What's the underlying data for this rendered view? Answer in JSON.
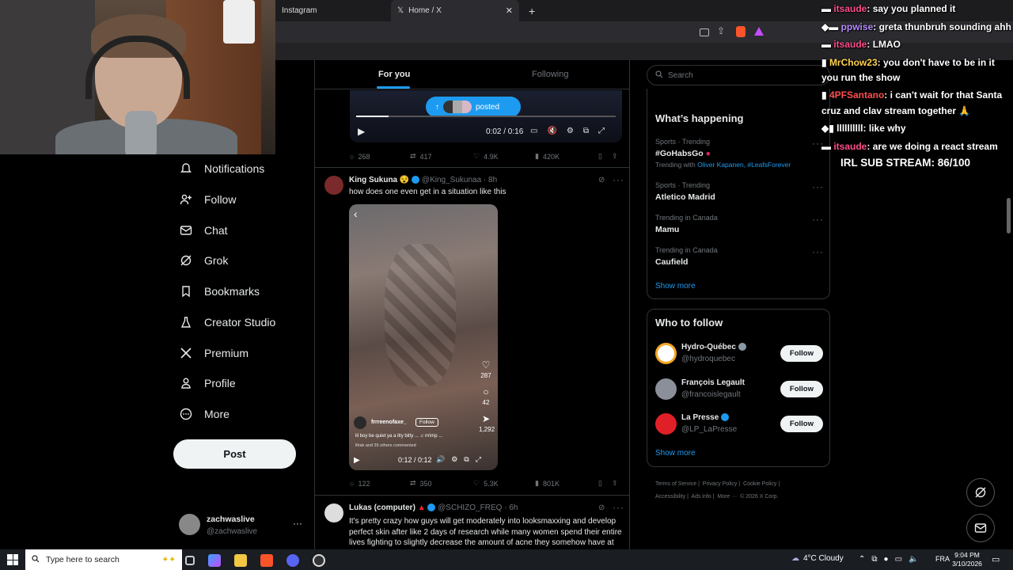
{
  "browser": {
    "tabs": [
      {
        "label": "Instagram"
      },
      {
        "label": "Home / X"
      }
    ],
    "new_tab": "+"
  },
  "nav": {
    "items": [
      {
        "label": "Notifications",
        "icon": "bell-icon"
      },
      {
        "label": "Follow",
        "icon": "person-plus-icon"
      },
      {
        "label": "Chat",
        "icon": "envelope-icon"
      },
      {
        "label": "Grok",
        "icon": "grok-icon"
      },
      {
        "label": "Bookmarks",
        "icon": "bookmark-icon"
      },
      {
        "label": "Creator Studio",
        "icon": "flask-icon"
      },
      {
        "label": "Premium",
        "icon": "x-logo-icon"
      },
      {
        "label": "Profile",
        "icon": "person-icon"
      },
      {
        "label": "More",
        "icon": "more-circle-icon"
      }
    ],
    "post_label": "Post",
    "account": {
      "name": "zachwaslive",
      "handle": "@zachwaslive",
      "more": "···"
    }
  },
  "timeline": {
    "tabs": {
      "for_you": "For you",
      "following": "Following"
    },
    "posted_pill": "posted",
    "tweet0": {
      "video_time": "0:02 / 0:16",
      "replies": "268",
      "reposts": "417",
      "likes": "4.9K",
      "views": "420K"
    },
    "tweet1": {
      "name": "King Sukuna",
      "handle": "@King_Sukunaa",
      "time": "· 8h",
      "text": "how does one even get in a situation like this",
      "video": {
        "username": "frrreenofaxe_",
        "follow": "Follow",
        "caption": "lil boy be quiet ya a itty bitty ... ♫ rrrimp ...",
        "comments_line": "lllrak and 35 others commented",
        "side_counts": [
          "287",
          "42",
          "1,292"
        ],
        "time": "0:12 / 0:12"
      },
      "replies": "122",
      "reposts": "350",
      "likes": "5.3K",
      "views": "801K"
    },
    "tweet2": {
      "name": "Lukas (computer)",
      "handle": "@SCHIZO_FREQ",
      "time": "· 6h",
      "text": "It's pretty crazy how guys will get moderately into looksmaxxing and develop perfect skin after like 2 days of research while many women spend their entire lives fighting to slightly decrease the amount of acne they somehow have at"
    }
  },
  "sidebar": {
    "search_placeholder": "Search",
    "whats_happening": "What’s happening",
    "trends": [
      {
        "meta": "Sports · Trending",
        "name": "#GoHabsGo",
        "extra_prefix": "Trending with",
        "extra_links": "Oliver Kapanen, #LeafsForever"
      },
      {
        "meta": "Sports · Trending",
        "name": "Atletico Madrid"
      },
      {
        "meta": "Trending in Canada",
        "name": "Mamu"
      },
      {
        "meta": "Trending in Canada",
        "name": "Caufield"
      }
    ],
    "show_more": "Show more",
    "who_to_follow": "Who to follow",
    "suggestions": [
      {
        "name": "Hydro-Québec",
        "handle": "@hydroquebec",
        "button": "Follow",
        "color": "#f5a623"
      },
      {
        "name": "François Legault",
        "handle": "@francoislegault",
        "button": "Follow",
        "color": "#8a8f99"
      },
      {
        "name": "La Presse",
        "handle": "@LP_LaPresse",
        "button": "Follow",
        "color": "#e02027"
      }
    ],
    "footer": [
      "Terms of Service",
      "Privacy Policy",
      "Cookie Policy",
      "Accessibility",
      "Ads info",
      "More ···",
      "© 2026 X Corp."
    ]
  },
  "chat": [
    {
      "user": "itsaude",
      "msg": ": say you planned it"
    },
    {
      "user": "ppwise",
      "msg": ": greta thunbruh sounding ahh"
    },
    {
      "user": "itsaude",
      "msg": ": LMAO"
    },
    {
      "user": "MrChow23",
      "msg": ": you don't have to be in it"
    },
    {
      "user": "",
      "msg": "you run the show"
    },
    {
      "user": "4PFSantano",
      "msg": ": i can't wait for that Santa"
    },
    {
      "user": "",
      "msg": "cruz and clav stream together 🙏"
    },
    {
      "user": "llllllllll",
      "msg": ": like why"
    },
    {
      "user": "itsaude",
      "msg": ": are we doing a react stream"
    }
  ],
  "sub_goal": "IRL SUB STREAM: 86/100",
  "taskbar": {
    "search_placeholder": "Type here to search",
    "weather": "4°C  Cloudy",
    "lang": "FRA",
    "time": "9:04 PM",
    "date": "3/10/2026"
  }
}
